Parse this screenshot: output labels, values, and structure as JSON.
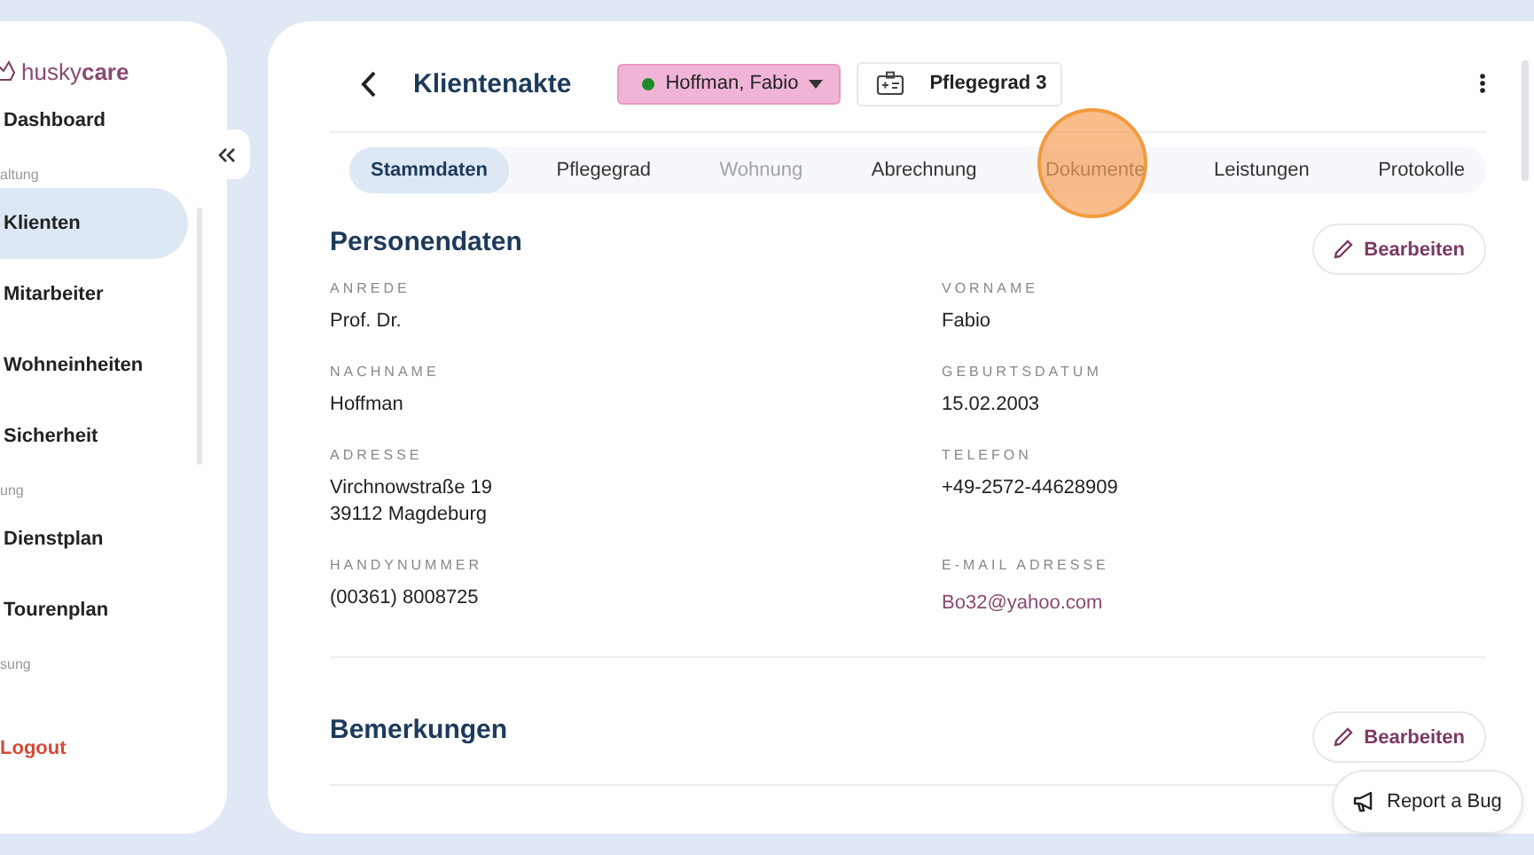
{
  "sidebar": {
    "logo": {
      "text_a": "husky",
      "text_b": "care"
    },
    "items": [
      {
        "kind": "item",
        "label": "Dashboard",
        "selected": false
      },
      {
        "kind": "section",
        "label": "altung"
      },
      {
        "kind": "item",
        "label": "Klienten",
        "selected": true
      },
      {
        "kind": "item",
        "label": "Mitarbeiter",
        "selected": false
      },
      {
        "kind": "item",
        "label": "Wohneinheiten",
        "selected": false
      },
      {
        "kind": "item",
        "label": "Sicherheit",
        "selected": false
      },
      {
        "kind": "section",
        "label": "ung"
      },
      {
        "kind": "item",
        "label": "Dienstplan",
        "selected": false
      },
      {
        "kind": "item",
        "label": "Tourenplan",
        "selected": false
      },
      {
        "kind": "section",
        "label": "sung"
      }
    ],
    "logout": "Logout"
  },
  "header": {
    "title": "Klientenakte",
    "client": "Hoffman, Fabio",
    "client_active": true,
    "care_level": "Pflegegrad 3"
  },
  "tabs": [
    {
      "label": "Stammdaten",
      "selected": true,
      "disabled": false
    },
    {
      "label": "Pflegegrad",
      "selected": false,
      "disabled": false
    },
    {
      "label": "Wohnung",
      "selected": false,
      "disabled": true
    },
    {
      "label": "Abrechnung",
      "selected": false,
      "disabled": false
    },
    {
      "label": "Dokumente",
      "selected": false,
      "disabled": false
    },
    {
      "label": "Leistungen",
      "selected": false,
      "disabled": false
    },
    {
      "label": "Protokolle",
      "selected": false,
      "disabled": false
    }
  ],
  "sections": [
    {
      "title": "Personendaten",
      "button": "Bearbeiten",
      "fields": [
        {
          "label": "ANREDE",
          "value": [
            "Prof. Dr."
          ],
          "kind": "text"
        },
        {
          "label": "VORNAME",
          "value": [
            "Fabio"
          ],
          "kind": "text"
        },
        {
          "label": "NACHNAME",
          "value": [
            "Hoffman"
          ],
          "kind": "text"
        },
        {
          "label": "GEBURTSDATUM",
          "value": [
            "15.02.2003"
          ],
          "kind": "text"
        },
        {
          "label": "ADRESSE",
          "value": [
            "Virchnowstraße 19",
            "39112 Magdeburg"
          ],
          "kind": "text"
        },
        {
          "label": "TELEFON",
          "value": [
            "+49-2572-44628909"
          ],
          "kind": "text"
        },
        {
          "label": "HANDYNUMMER",
          "value": [
            "(00361) 8008725"
          ],
          "kind": "text"
        },
        {
          "label": "E-MAIL ADRESSE",
          "value": [
            "Bo32@yahoo.com"
          ],
          "kind": "email"
        }
      ]
    },
    {
      "title": "Bemerkungen",
      "button": "Bearbeiten"
    }
  ],
  "report_button": "Report a Bug"
}
